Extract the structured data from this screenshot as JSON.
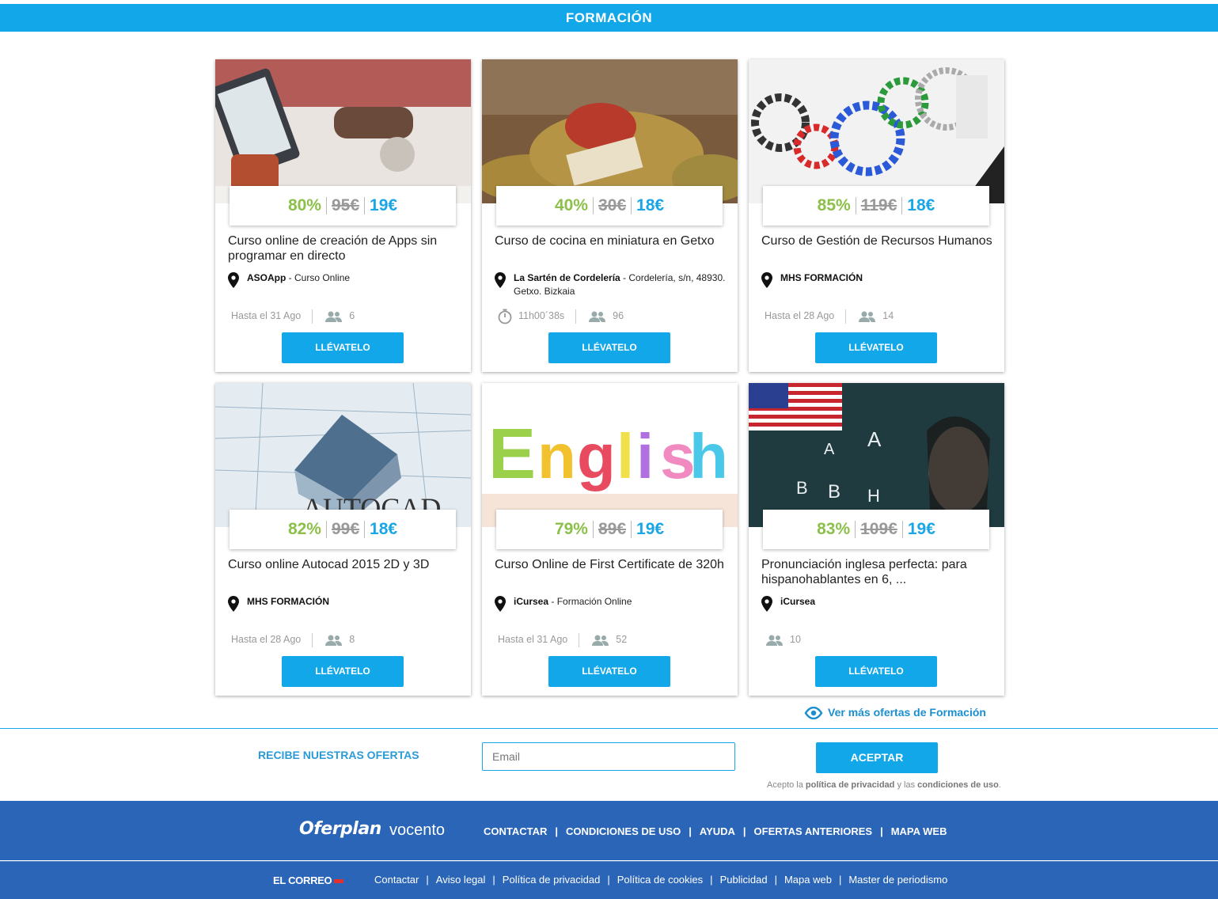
{
  "header": {
    "title": "FORMACIÓN"
  },
  "cards": [
    {
      "image": "apps-course-photo",
      "discount": "80%",
      "old_price": "95€",
      "price": "19€",
      "title": "Curso online de creación de Apps sin programar en directo",
      "merchant": "ASOApp",
      "merchant_detail": " - Curso Online",
      "deadline": "Hasta el 31 Ago",
      "buyers": "6",
      "button": "LLÉVATELO"
    },
    {
      "image": "miniature-cooking-photo",
      "discount": "40%",
      "old_price": "30€",
      "price": "18€",
      "title": "Curso de cocina en miniatura en Getxo",
      "merchant": "La Sartén de Cordelería",
      "merchant_detail": " - Cordelería, s/n, 48930. Getxo. Bizkaia",
      "deadline": "11h00´38s",
      "buyers": "96",
      "button": "LLÉVATELO"
    },
    {
      "image": "hr-gears-photo",
      "discount": "85%",
      "old_price": "119€",
      "price": "18€",
      "title": "Curso de Gestión de Recursos Humanos",
      "merchant": "MHS FORMACIÓN",
      "merchant_detail": "",
      "deadline": "Hasta el 28 Ago",
      "buyers": "14",
      "button": "LLÉVATELO"
    },
    {
      "image": "autocad-house-photo",
      "discount": "82%",
      "old_price": "99€",
      "price": "18€",
      "title": "Curso online Autocad 2015 2D y 3D",
      "merchant": "MHS FORMACIÓN",
      "merchant_detail": "",
      "deadline": "Hasta el 28 Ago",
      "buyers": "8",
      "button": "LLÉVATELO"
    },
    {
      "image": "english-letters-photo",
      "discount": "79%",
      "old_price": "89€",
      "price": "19€",
      "title": "Curso Online de First Certificate de 320h",
      "merchant": "iCursea",
      "merchant_detail": " - Formación Online",
      "deadline": "Hasta el 31 Ago",
      "buyers": "52",
      "button": "LLÉVATELO"
    },
    {
      "image": "english-pronunciation-photo",
      "discount": "83%",
      "old_price": "109€",
      "price": "19€",
      "title": "Pronunciación inglesa perfecta: para hispanohablantes en 6, ...",
      "merchant": "iCursea",
      "merchant_detail": "",
      "deadline": "",
      "buyers": "10",
      "button": "LLÉVATELO"
    }
  ],
  "more_link": "Ver más ofertas de Formación",
  "newsletter": {
    "label": "RECIBE NUESTRAS OFERTAS",
    "email_placeholder": "Email",
    "submit": "ACEPTAR",
    "legal_prefix": "Acepto la ",
    "privacy": "política de privacidad",
    "legal_mid": " y las ",
    "terms": "condiciones de uso",
    "legal_suffix": "."
  },
  "footer": {
    "brand": "Oferplan",
    "group": "vocento",
    "nav": [
      "CONTACTAR",
      "CONDICIONES DE USO",
      "AYUDA",
      "OFERTAS ANTERIORES",
      "MAPA WEB"
    ],
    "newspaper": "EL CORREO",
    "links": [
      "Contactar",
      "Aviso legal",
      "Política de privacidad",
      "Política de cookies",
      "Publicidad",
      "Mapa web",
      "Master de periodismo"
    ]
  },
  "colors": {
    "accent": "#12a7e8",
    "discount": "#8cc04b",
    "footer": "#2b65b8"
  }
}
